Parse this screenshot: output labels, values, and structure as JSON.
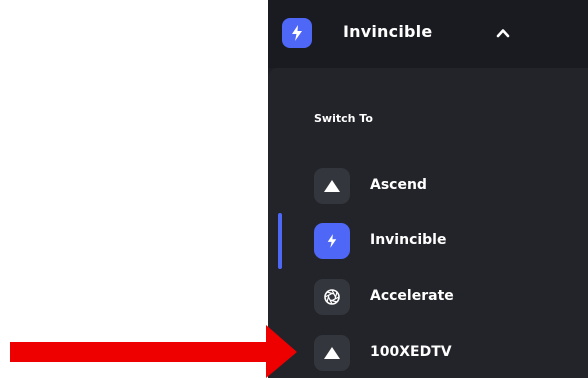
{
  "header": {
    "app_name": "Invincible",
    "app_icon": "bolt-icon",
    "toggle_icon": "chevron-up-icon"
  },
  "dropdown": {
    "section_label": "Switch To",
    "items": [
      {
        "label": "Ascend",
        "icon": "mountain-icon",
        "active": false
      },
      {
        "label": "Invincible",
        "icon": "bolt-icon",
        "active": true
      },
      {
        "label": "Accelerate",
        "icon": "aperture-icon",
        "active": false
      },
      {
        "label": "100XEDTV",
        "icon": "mountain-icon",
        "active": false
      }
    ]
  },
  "annotation": {
    "arrow_color": "#ee0000",
    "points_to": "100XEDTV"
  },
  "colors": {
    "accent": "#4e67f6",
    "panel_bg": "#1e1f24",
    "icon_bg": "#34363e"
  }
}
